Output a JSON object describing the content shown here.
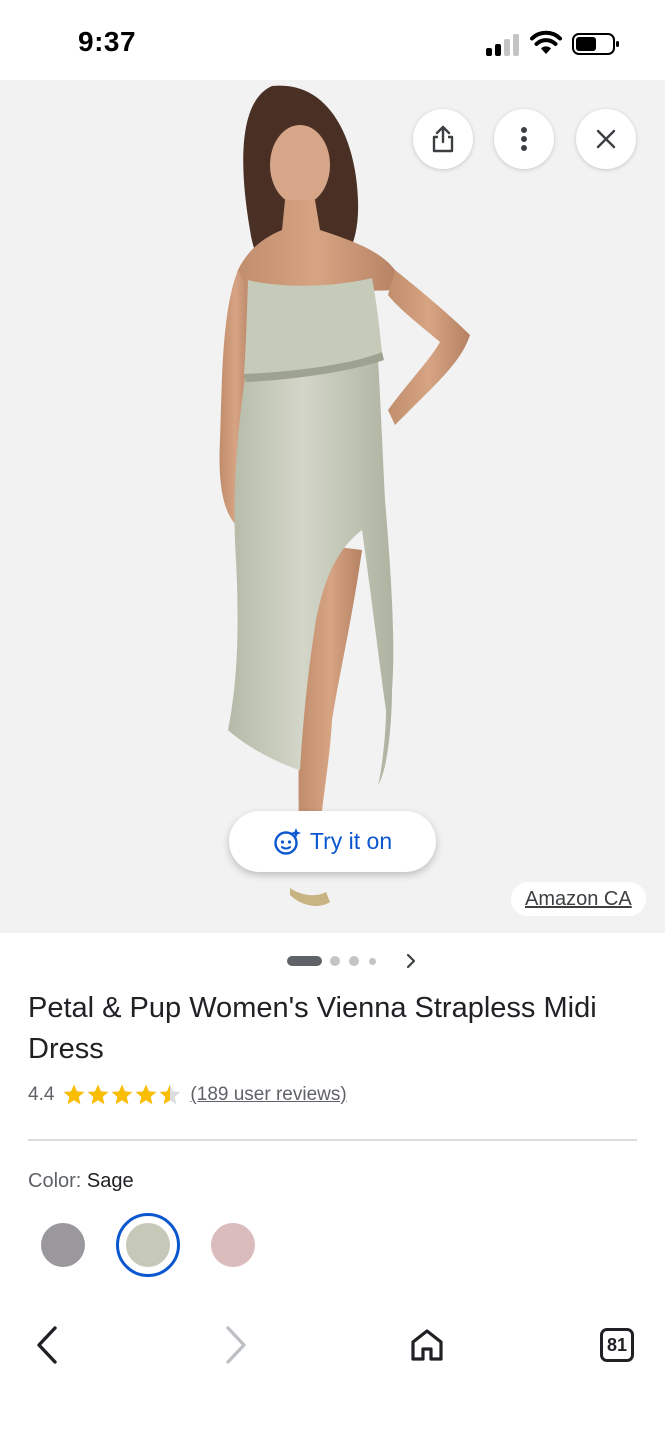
{
  "status_bar": {
    "time": "9:37"
  },
  "hero": {
    "actions": [
      {
        "name": "share-icon"
      },
      {
        "name": "more-vert-icon"
      },
      {
        "name": "close-icon"
      }
    ],
    "try_on_label": "Try it on",
    "source_label": "Amazon CA"
  },
  "pager": {
    "pages": 4,
    "active_index": 0
  },
  "product": {
    "title": "Petal & Pup Women's Vienna Strapless Midi Dress",
    "rating": "4.4",
    "rating_value": 4.4,
    "stars_max": 5,
    "reviews": "(189 user reviews)",
    "color_label": "Color:",
    "color_value": "Sage",
    "swatches": [
      {
        "color": "#9a989c",
        "selected": false
      },
      {
        "color": "#c7c9b8",
        "selected": true
      },
      {
        "color": "#dbbcbc",
        "selected": false
      }
    ]
  },
  "bottom_nav": {
    "tabs_count": "81"
  },
  "colors": {
    "accent": "#0b57d0",
    "star": "#fbbc04",
    "background": "#f2f2f2"
  }
}
